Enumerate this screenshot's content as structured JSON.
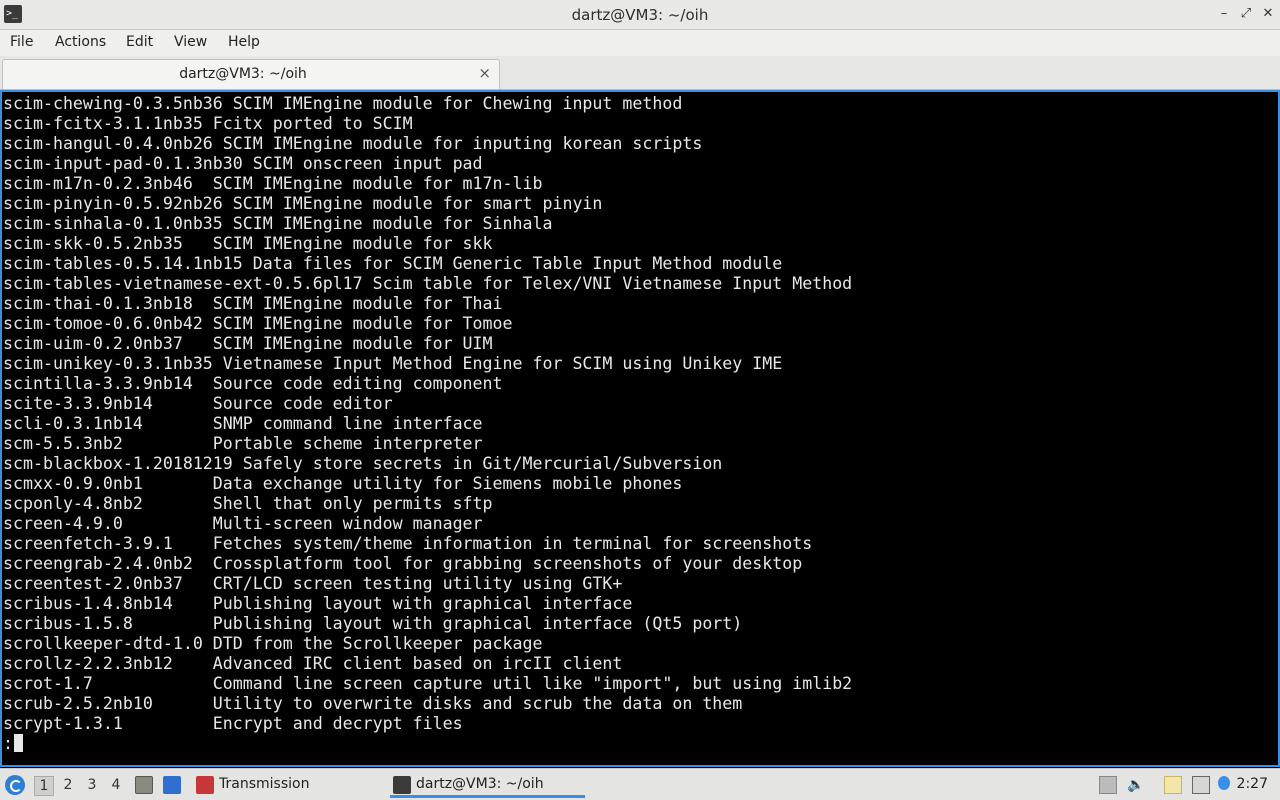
{
  "window": {
    "title": "dartz@VM3: ~/oih",
    "icon": "terminal-icon"
  },
  "menu": {
    "items": [
      "File",
      "Actions",
      "Edit",
      "View",
      "Help"
    ]
  },
  "tab": {
    "label": "dartz@VM3: ~/oih",
    "close": "×"
  },
  "terminal": {
    "lines": [
      "scim-chewing-0.3.5nb36 SCIM IMEngine module for Chewing input method",
      "scim-fcitx-3.1.1nb35 Fcitx ported to SCIM",
      "scim-hangul-0.4.0nb26 SCIM IMEngine module for inputing korean scripts",
      "scim-input-pad-0.1.3nb30 SCIM onscreen input pad",
      "scim-m17n-0.2.3nb46  SCIM IMEngine module for m17n-lib",
      "scim-pinyin-0.5.92nb26 SCIM IMEngine module for smart pinyin",
      "scim-sinhala-0.1.0nb35 SCIM IMEngine module for Sinhala",
      "scim-skk-0.5.2nb35   SCIM IMEngine module for skk",
      "scim-tables-0.5.14.1nb15 Data files for SCIM Generic Table Input Method module",
      "scim-tables-vietnamese-ext-0.5.6pl17 Scim table for Telex/VNI Vietnamese Input Method",
      "scim-thai-0.1.3nb18  SCIM IMEngine module for Thai",
      "scim-tomoe-0.6.0nb42 SCIM IMEngine module for Tomoe",
      "scim-uim-0.2.0nb37   SCIM IMEngine module for UIM",
      "scim-unikey-0.3.1nb35 Vietnamese Input Method Engine for SCIM using Unikey IME",
      "scintilla-3.3.9nb14  Source code editing component",
      "scite-3.3.9nb14      Source code editor",
      "scli-0.3.1nb14       SNMP command line interface",
      "scm-5.5.3nb2         Portable scheme interpreter",
      "scm-blackbox-1.20181219 Safely store secrets in Git/Mercurial/Subversion",
      "scmxx-0.9.0nb1       Data exchange utility for Siemens mobile phones",
      "scponly-4.8nb2       Shell that only permits sftp",
      "screen-4.9.0         Multi-screen window manager",
      "screenfetch-3.9.1    Fetches system/theme information in terminal for screenshots",
      "screengrab-2.4.0nb2  Crossplatform tool for grabbing screenshots of your desktop",
      "screentest-2.0nb37   CRT/LCD screen testing utility using GTK+",
      "scribus-1.4.8nb14    Publishing layout with graphical interface",
      "scribus-1.5.8        Publishing layout with graphical interface (Qt5 port)",
      "scrollkeeper-dtd-1.0 DTD from the Scrollkeeper package",
      "scrollz-2.2.3nb12    Advanced IRC client based on ircII client",
      "scrot-1.7            Command line screen capture util like \"import\", but using imlib2",
      "scrub-2.5.2nb10      Utility to overwrite disks and scrub the data on them",
      "scrypt-1.3.1         Encrypt and decrypt files"
    ],
    "prompt": ":"
  },
  "taskbar": {
    "workspaces": [
      "1",
      "2",
      "3",
      "4"
    ],
    "active_workspace": "1",
    "tasks": [
      {
        "label": "Transmission",
        "icon": "transmission-icon"
      },
      {
        "label": "dartz@VM3: ~/oih",
        "icon": "terminal-icon"
      }
    ],
    "clock": "2:27"
  },
  "colors": {
    "accent": "#3a8ee6",
    "terminal_bg": "#000000",
    "terminal_fg": "#e8e8e8"
  }
}
